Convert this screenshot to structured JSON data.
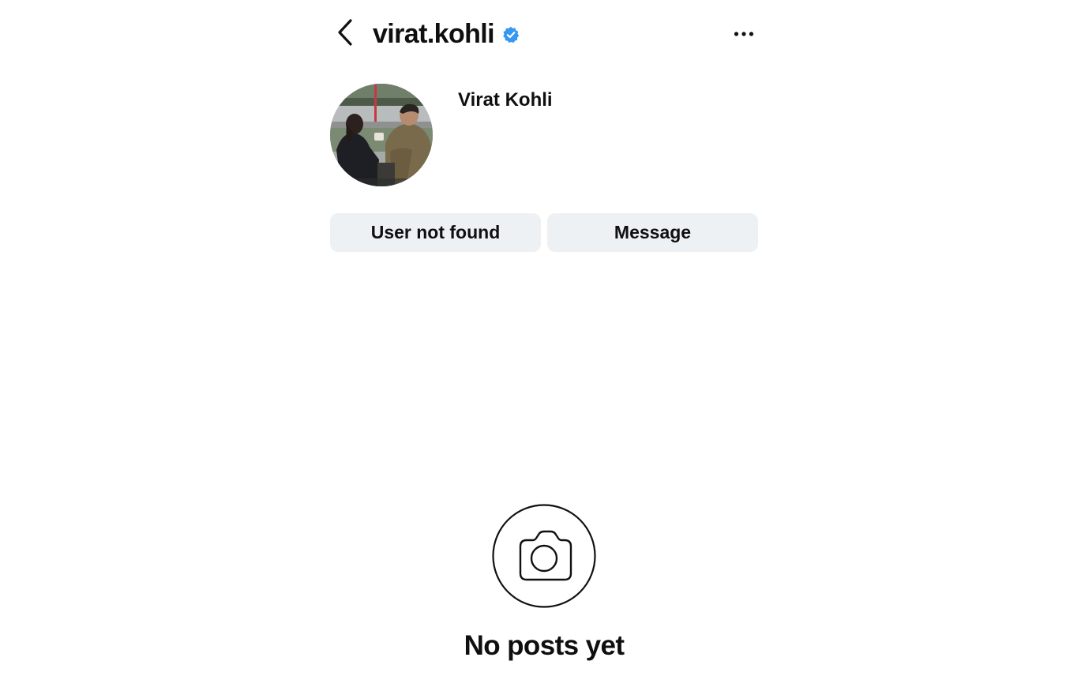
{
  "header": {
    "username": "virat.kohli",
    "back_icon": "chevron-left-icon",
    "verified_icon": "verified-badge-icon",
    "verified_color": "#3897f0",
    "more_icon": "more-horizontal-icon"
  },
  "profile": {
    "display_name": "Virat Kohli"
  },
  "actions": {
    "follow_label": "User not found",
    "message_label": "Message"
  },
  "empty_state": {
    "icon": "camera-icon",
    "title": "No posts yet"
  }
}
